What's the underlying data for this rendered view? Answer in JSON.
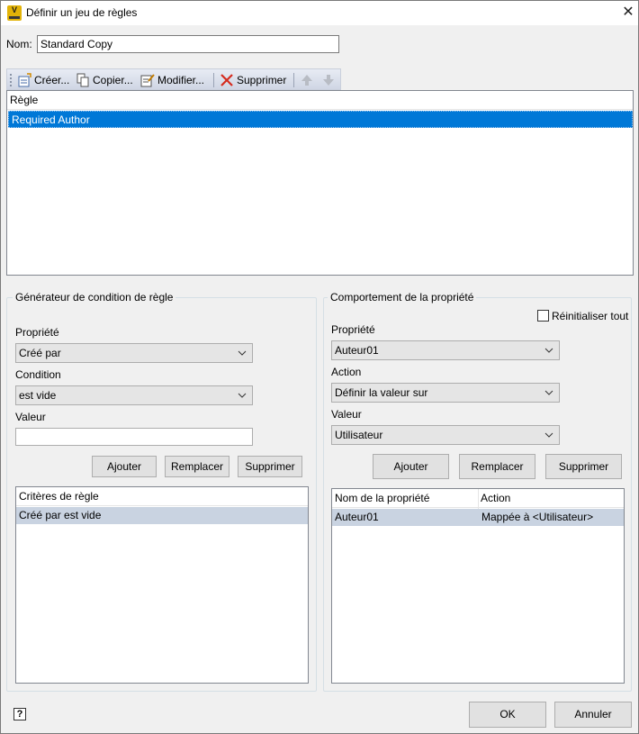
{
  "window": {
    "title": "Définir un jeu de règles",
    "app_icon_letter": "V",
    "close_glyph": "✕"
  },
  "name_field": {
    "label": "Nom:",
    "value": "Standard Copy"
  },
  "toolbar": {
    "create_label": "Créer...",
    "copy_label": "Copier...",
    "modify_label": "Modifier...",
    "delete_label": "Supprimer",
    "icons": [
      "create-rule-icon",
      "copy-icon",
      "modify-icon",
      "delete-x-icon",
      "move-up-icon",
      "move-down-icon"
    ]
  },
  "rules_list": {
    "header": "Règle",
    "rows": [
      "Required Author"
    ],
    "selected_color": "#0078d7"
  },
  "condition_builder": {
    "title": "Générateur de condition de règle",
    "property_label": "Propriété",
    "property_value": "Créé par",
    "condition_label": "Condition",
    "condition_value": "est vide",
    "value_label": "Valeur",
    "value_value": "",
    "add_label": "Ajouter",
    "replace_label": "Remplacer",
    "delete_label": "Supprimer",
    "criteria_header": "Critères de règle",
    "criteria_rows": [
      "Créé par est vide"
    ]
  },
  "property_behavior": {
    "title": "Comportement de la propriété",
    "reset_all_label": "Réinitialiser tout",
    "reset_all_checked": false,
    "property_label": "Propriété",
    "property_value": "Auteur01",
    "action_label": "Action",
    "action_value": "Définir la valeur sur",
    "value_label": "Valeur",
    "value_value": "Utilisateur",
    "add_label": "Ajouter",
    "replace_label": "Remplacer",
    "delete_label": "Supprimer",
    "table": {
      "columns": [
        "Nom de la propriété",
        "Action"
      ],
      "rows": [
        {
          "property": "Auteur01",
          "action": "Mappée à <Utilisateur>"
        }
      ]
    }
  },
  "footer": {
    "help_glyph": "?",
    "ok_label": "OK",
    "cancel_label": "Annuler"
  }
}
